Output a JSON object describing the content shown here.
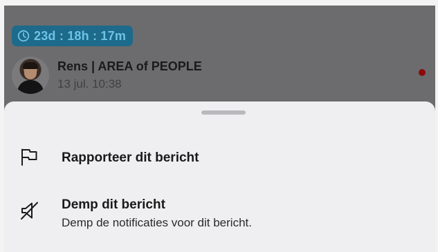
{
  "background": {
    "timer": "23d : 18h : 17m",
    "sender_name": "Rens | AREA of PEOPLE",
    "sent_time": "13 jul. 10:38"
  },
  "sheet": {
    "actions": [
      {
        "title": "Rapporteer dit bericht",
        "icon": "flag-icon"
      },
      {
        "title": "Demp dit bericht",
        "subtitle": "Demp de notificaties voor dit bericht.",
        "icon": "mute-icon"
      }
    ]
  },
  "colors": {
    "timer_badge_bg": "#1d6a8a",
    "timer_badge_text": "#6ec3e6",
    "unread_dot": "#8d0a0a",
    "sheet_bg": "#efeff1"
  }
}
